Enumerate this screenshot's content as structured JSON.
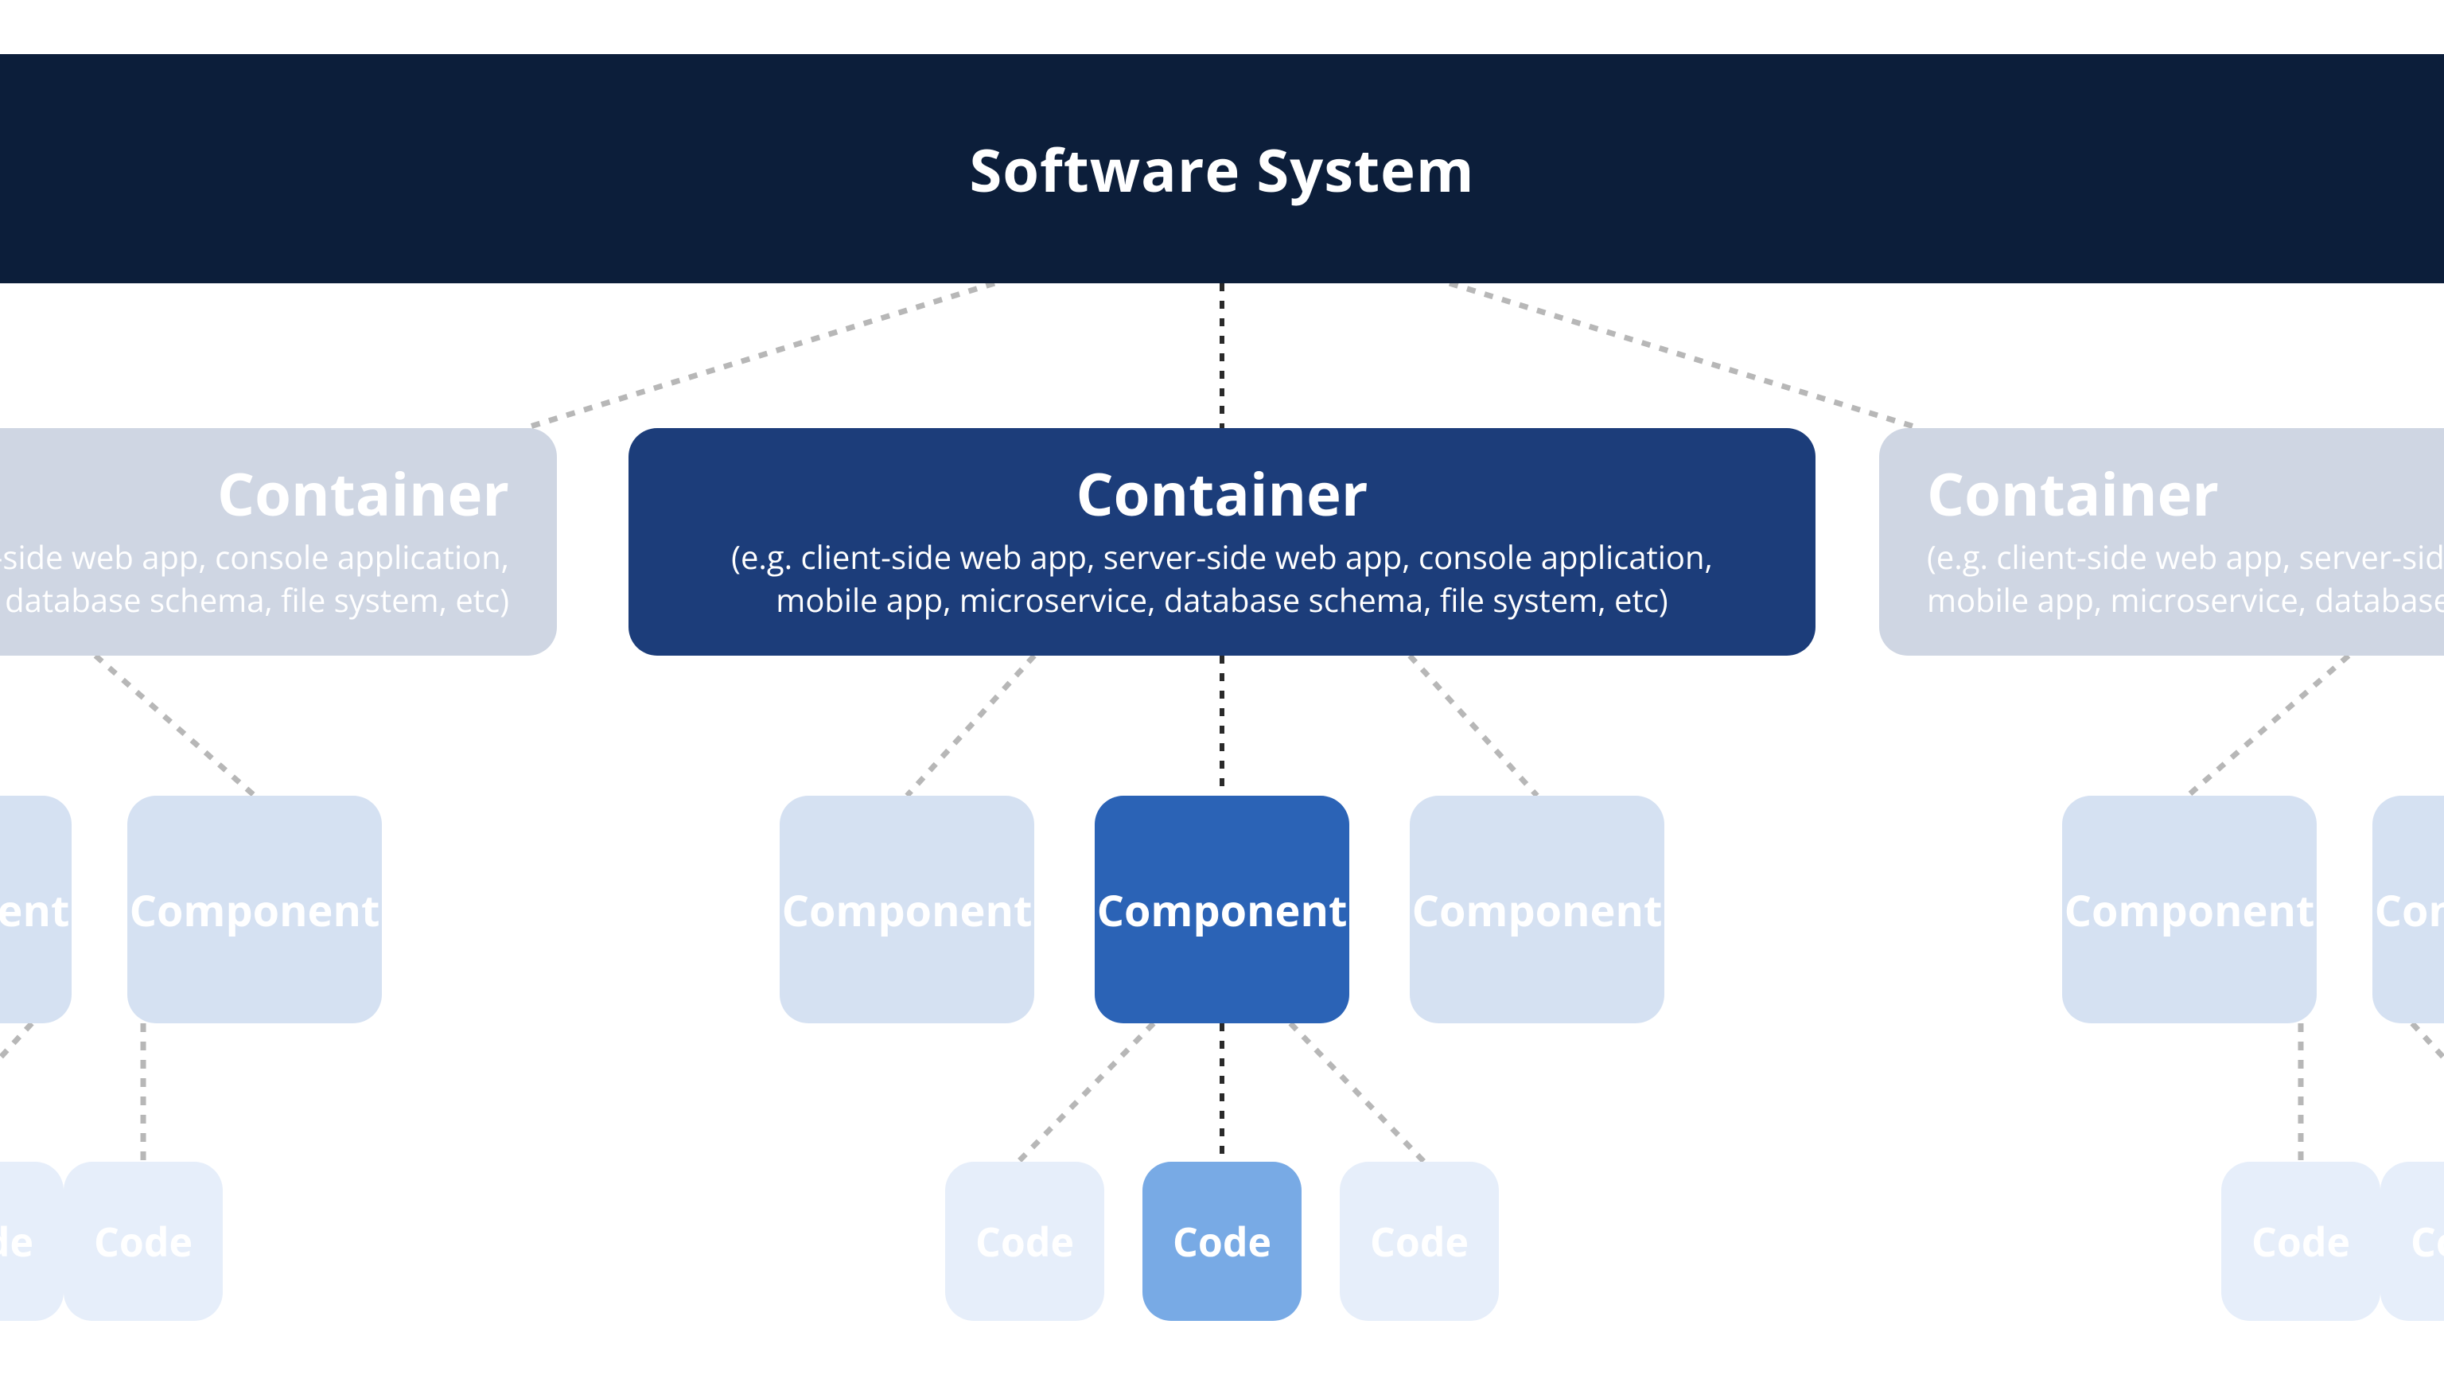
{
  "system": {
    "title": "Software System"
  },
  "containers": {
    "left": {
      "title": "Container",
      "sub_fragment1": "(e.g. client-side web app, server-side web app, console application,",
      "sub_fragment2": "mobile app, microservice, database schema, file system, etc)"
    },
    "center": {
      "title": "Container",
      "sub1": "(e.g. client-side web app, server-side web app, console application,",
      "sub2": "mobile app, microservice, database schema, file system, etc)"
    },
    "right": {
      "title": "Container",
      "sub_fragment1": "(e.g. client-side web app, server-side web app, console application,",
      "sub_fragment2": "mobile app, microservice, database schema, file system, etc)"
    }
  },
  "components": {
    "far_left_a": "Component",
    "far_left_b": "Component",
    "center_left": "Component",
    "center_main": "Component",
    "center_right": "Component",
    "far_right_a": "Component",
    "far_right_b": "Component"
  },
  "code": {
    "far_left": "Code",
    "mid_left": "Code",
    "center_left": "Code",
    "center_main": "Code",
    "center_right": "Code",
    "far_right": "Code"
  },
  "colors": {
    "system": "#0c1e3a",
    "container_active": "#1c3d7a",
    "container_faded": "#cfd6e3",
    "component_active": "#2b63b6",
    "component_faded": "#d5e1f2",
    "code_active": "#78aae5",
    "code_faded": "#e6eefa"
  }
}
